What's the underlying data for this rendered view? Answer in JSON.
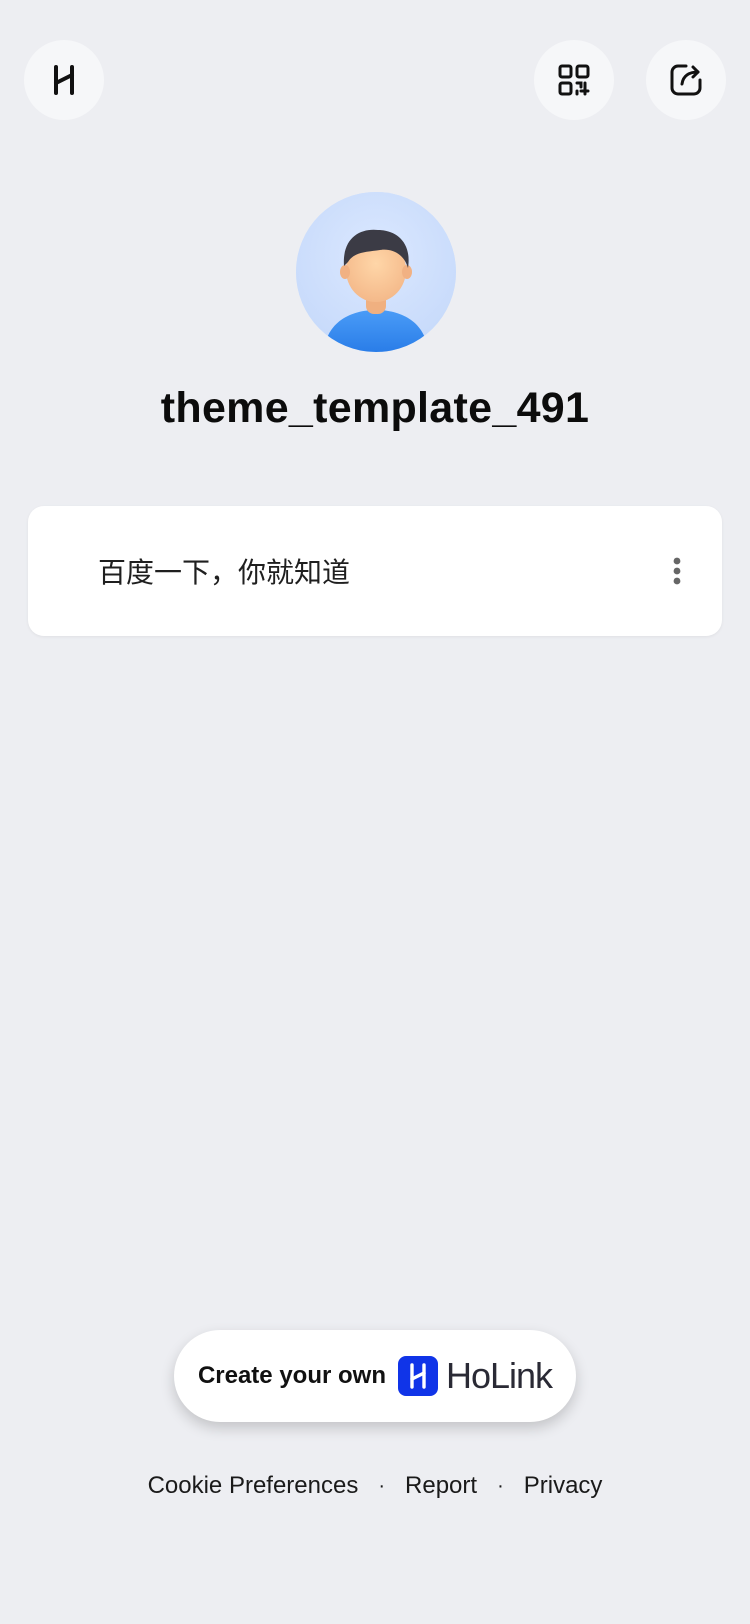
{
  "header": {
    "logo_icon": "holink-logo-icon",
    "qr_icon": "qr-code-icon",
    "share_icon": "share-icon"
  },
  "profile": {
    "avatar_icon": "user-avatar",
    "username": "theme_template_491"
  },
  "links": [
    {
      "label": "百度一下，你就知道",
      "menu_icon": "more-vertical-icon"
    }
  ],
  "cta": {
    "text": "Create your own",
    "brand": "HoLink",
    "brand_color": "#1034e8"
  },
  "footer": {
    "cookie": "Cookie Preferences",
    "separator": "·",
    "report": "Report",
    "privacy": "Privacy"
  },
  "colors": {
    "background": "#edeef2",
    "card": "#ffffff"
  }
}
